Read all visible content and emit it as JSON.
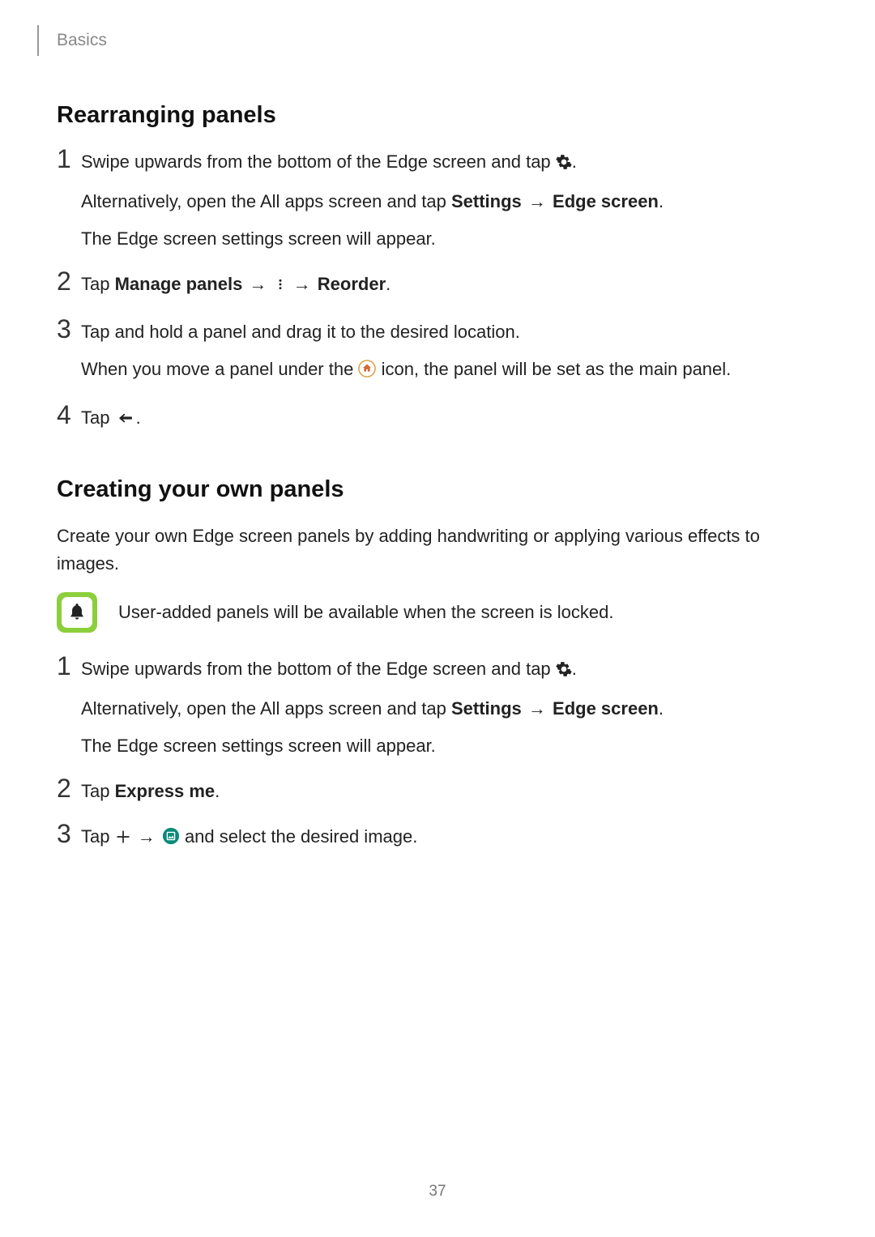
{
  "breadcrumb": "Basics",
  "page_number": "37",
  "section1": {
    "heading": "Rearranging panels",
    "steps": {
      "s1": {
        "num": "1",
        "p1a": "Swipe upwards from the bottom of the Edge screen and tap ",
        "p1b": ".",
        "p2a": "Alternatively, open the All apps screen and tap ",
        "bold_settings": "Settings",
        "arrow": " → ",
        "bold_edge": "Edge screen",
        "p2b": ".",
        "p3": "The Edge screen settings screen will appear."
      },
      "s2": {
        "num": "2",
        "tap": "Tap ",
        "bold_manage": "Manage panels",
        "arrow1": " → ",
        "arrow2": " → ",
        "bold_reorder": "Reorder",
        "end": "."
      },
      "s3": {
        "num": "3",
        "p1": "Tap and hold a panel and drag it to the desired location.",
        "p2a": "When you move a panel under the ",
        "p2b": " icon, the panel will be set as the main panel."
      },
      "s4": {
        "num": "4",
        "tap": "Tap ",
        "end": "."
      }
    }
  },
  "section2": {
    "heading": "Creating your own panels",
    "intro": "Create your own Edge screen panels by adding handwriting or applying various effects to images.",
    "note": "User-added panels will be available when the screen is locked.",
    "steps": {
      "s1": {
        "num": "1",
        "p1a": "Swipe upwards from the bottom of the Edge screen and tap ",
        "p1b": ".",
        "p2a": "Alternatively, open the All apps screen and tap ",
        "bold_settings": "Settings",
        "arrow": " → ",
        "bold_edge": "Edge screen",
        "p2b": ".",
        "p3": "The Edge screen settings screen will appear."
      },
      "s2": {
        "num": "2",
        "tap": "Tap ",
        "bold_express": "Express me",
        "end": "."
      },
      "s3": {
        "num": "3",
        "tap": "Tap ",
        "arrow1": " → ",
        "rest": " and select the desired image."
      }
    }
  }
}
